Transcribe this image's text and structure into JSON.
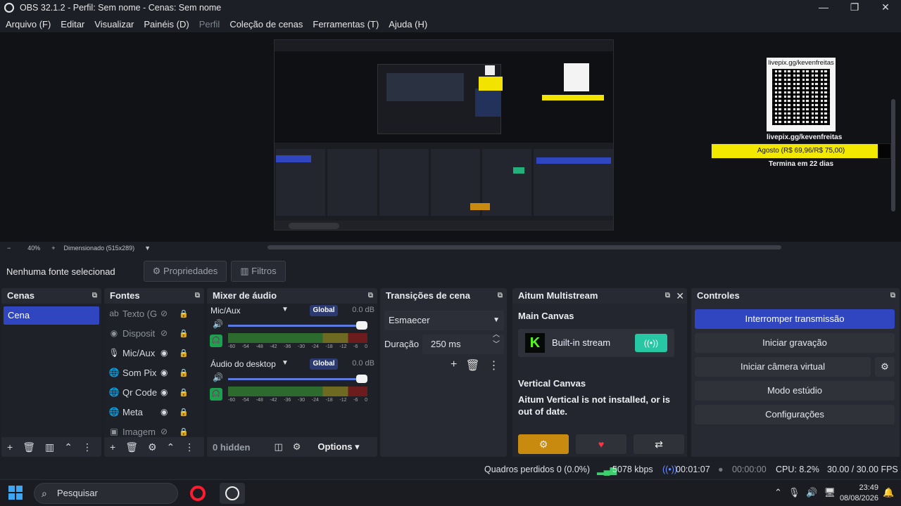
{
  "window": {
    "title": "OBS 32.1.2 - Perfil: Sem nome - Cenas: Sem nome",
    "minimize": "—",
    "maximize": "❐",
    "close": "✕"
  },
  "menu": [
    "Arquivo (F)",
    "Editar",
    "Visualizar",
    "Painéis (D)",
    "Perfil",
    "Coleção de cenas",
    "Ferramentas (T)",
    "Ajuda (H)"
  ],
  "overlay": {
    "livepix_top": "livepix.gg/kevenfreitas",
    "livepix_bottom": "livepix.gg/kevenfreitas",
    "goal": "Agosto (R$ 69,96/R$ 75,00)",
    "goal_progress": 0.93,
    "ends": "Termina em 22 dias"
  },
  "zoom": {
    "minus": "−",
    "level": "40%",
    "plus": "+",
    "mode": "Dimensionado (515x289)",
    "caret": "▼"
  },
  "source_bar": {
    "none_selected": "Nenhuma fonte selecionad",
    "properties": "Propriedades",
    "filters": "Filtros"
  },
  "scenes": {
    "title": "Cenas",
    "items": [
      "Cena"
    ]
  },
  "sources": {
    "title": "Fontes",
    "items": [
      {
        "name": "Texto (G",
        "icon": "text-icon",
        "glyph": "ab",
        "dim": true
      },
      {
        "name": "Disposit",
        "icon": "camera-icon",
        "glyph": "◉",
        "dim": true
      },
      {
        "name": "Mic/Aux",
        "icon": "mic-icon",
        "glyph": "🎙",
        "dim": false
      },
      {
        "name": "Som Pix",
        "icon": "globe-icon",
        "glyph": "🌐",
        "dim": false
      },
      {
        "name": "Qr Code",
        "icon": "globe-icon",
        "glyph": "🌐",
        "dim": false
      },
      {
        "name": "Meta",
        "icon": "globe-icon",
        "glyph": "🌐",
        "dim": false
      },
      {
        "name": "Imagem",
        "icon": "image-icon",
        "glyph": "▣",
        "dim": true
      }
    ]
  },
  "mixer": {
    "title": "Mixer de áudio",
    "channels": [
      {
        "name": "Mic/Aux",
        "badge": "Global",
        "db": "0.0 dB",
        "volume": 1.0
      },
      {
        "name": "Áudio do desktop",
        "badge": "Global",
        "db": "0.0 dB",
        "volume": 1.0
      }
    ],
    "ticks": [
      "-60",
      "-54",
      "-48",
      "-42",
      "-36",
      "-30",
      "-24",
      "-18",
      "-12",
      "-6",
      "0"
    ],
    "hidden": "0 hidden",
    "options": "Options"
  },
  "transitions": {
    "title": "Transições de cena",
    "selected": "Esmaecer",
    "duration_label": "Duração",
    "duration_value": "250 ms"
  },
  "altium": {
    "title": "Aitum Multistream",
    "main_canvas": "Main Canvas",
    "stream_label": "Built-in stream",
    "vertical_canvas": "Vertical Canvas",
    "warning": "Aitum Vertical is not installed, or is out of date."
  },
  "controls": {
    "title": "Controles",
    "buttons": [
      "Interromper transmissão",
      "Iniciar gravação",
      "Iniciar câmera virtual",
      "Modo estúdio",
      "Configurações"
    ]
  },
  "status": {
    "dropped": "Quadros perdidos 0 (0.0%)",
    "bitrate": "5078 kbps",
    "live_time": "00:01:07",
    "rec_time": "00:00:00",
    "cpu": "CPU: 8.2%",
    "fps": "30.00 / 30.00 FPS"
  },
  "taskbar": {
    "search": "Pesquisar",
    "time": "23:49",
    "date": "08/08/2026"
  },
  "colors": {
    "accent": "#2f46c0",
    "live": "#26c7a2",
    "goal": "#f2e800"
  }
}
